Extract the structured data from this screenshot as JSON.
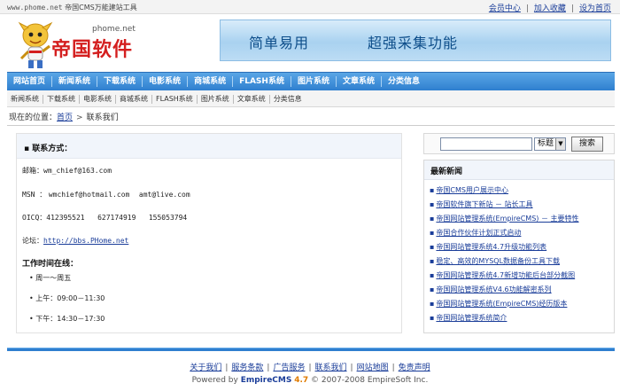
{
  "topbar": {
    "url": "www.phome.net",
    "site_desc": "帝国CMS万能建站工具",
    "links": [
      "会员中心",
      "加入收藏",
      "设为首页"
    ]
  },
  "logo": {
    "domain": "phome.net",
    "brand": "帝国软件"
  },
  "banner": {
    "slogan1": "简单易用",
    "slogan2": "超强采集功能"
  },
  "mainnav": [
    "网站首页",
    "新闻系统",
    "下载系统",
    "电影系统",
    "商城系统",
    "FLASH系统",
    "图片系统",
    "文章系统",
    "分类信息"
  ],
  "subnav": [
    "新闻系统",
    "下载系统",
    "电影系统",
    "商城系统",
    "FLASH系统",
    "图片系统",
    "文章系统",
    "分类信息"
  ],
  "breadcrumb": {
    "prefix": "现在的位置：",
    "home": "首页",
    "sep": ">",
    "current": "联系我们"
  },
  "contact": {
    "title": "▪ 联系方式：",
    "email_label": "邮箱：",
    "email_value": "wm_chief@163.com",
    "msn_label": "MSN ：",
    "msn_value1": "wmchief@hotmail.com",
    "msn_value2": "amt@live.com",
    "qq_label": "OICQ：",
    "qq_values": "412395521   627174919   155053794",
    "forum_label": "论坛：",
    "forum_url": "http://bbs.PHome.net",
    "hours_title": "工作时间在线：",
    "hours": [
      "周一～周五",
      "上午：09:00－11:30",
      "下午：14:30－17:30"
    ]
  },
  "search": {
    "select_value": "标题",
    "button": "搜索"
  },
  "news": {
    "title": "最新新闻",
    "items": [
      "帝国CMS用户展示中心",
      "帝国软件旗下新站 － 站长工具",
      "帝国网站管理系统(EmpireCMS) － 主要特性",
      "帝国合作伙伴计划正式启动",
      "帝国网站管理系统4.7升级功能列表",
      "稳定、高效的MYSQL数据备份工具下载",
      "帝国网站管理系统4.7新增功能后台部分截图",
      "帝国网站管理系统V4.6功能解密系列",
      "帝国网站管理系统(EmpireCMS)经历版本",
      "帝国网站管理系统简介"
    ]
  },
  "footer": {
    "links": [
      "关于我们",
      "服务条款",
      "广告服务",
      "联系我们",
      "网站地图",
      "免责声明"
    ],
    "powered_prefix": "Powered by",
    "product": "EmpireCMS",
    "version": "4.7",
    "copyright": "© 2007-2008 EmpireSoft Inc."
  },
  "colors": {
    "nav": "#2f7fcf",
    "brand_red": "#d41f1f",
    "link": "#1a3d99"
  }
}
